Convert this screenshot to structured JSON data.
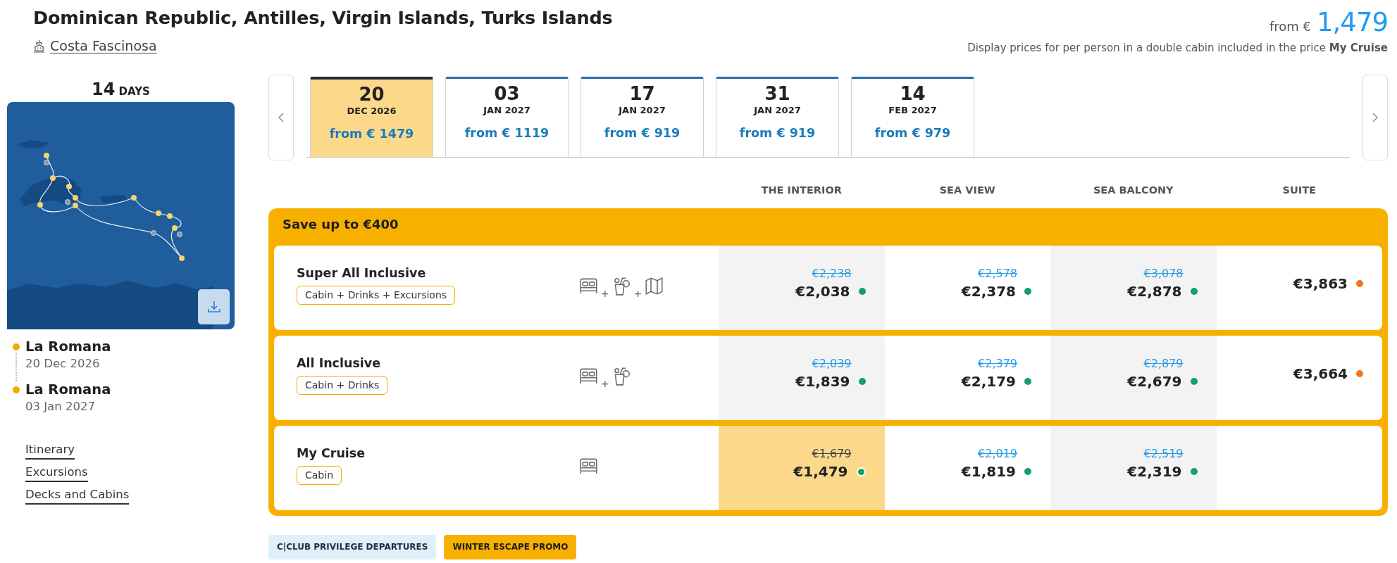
{
  "header": {
    "title": "Dominican Republic, Antilles, Virgin Islands, Turks Islands",
    "ship": "Costa Fascinosa",
    "price_prefix": "from €",
    "price": "1,479",
    "note": "Display prices for per person in a double cabin included in the price **My Cruise**"
  },
  "sidebar": {
    "duration": "14",
    "duration_unit": "DAYS",
    "stops": [
      {
        "port": "La Romana",
        "date": "20 Dec 2026"
      },
      {
        "port": "La Romana",
        "date": "03 Jan 2027"
      }
    ],
    "links": [
      "Itinerary",
      "Excursions",
      "Decks and Cabins"
    ]
  },
  "date_tabs": [
    {
      "day": "20",
      "month": "DEC 2026",
      "price": "from € 1479",
      "selected": true
    },
    {
      "day": "03",
      "month": "JAN 2027",
      "price": "from € 1119",
      "selected": false
    },
    {
      "day": "17",
      "month": "JAN 2027",
      "price": "from € 919",
      "selected": false
    },
    {
      "day": "31",
      "month": "JAN 2027",
      "price": "from € 919",
      "selected": false
    },
    {
      "day": "14",
      "month": "FEB 2027",
      "price": "from € 979",
      "selected": false
    }
  ],
  "cabin_columns": [
    "THE INTERIOR",
    "SEA VIEW",
    "SEA BALCONY",
    "SUITE"
  ],
  "offers": {
    "banner": "Save up to €400",
    "rows": [
      {
        "name": "Super All Inclusive",
        "badge": "Cabin + Drinks + Excursions",
        "includes": [
          {
            "kind": "cabin"
          },
          {
            "kind": "joiner",
            "text": "+"
          },
          {
            "kind": "drinks"
          },
          {
            "kind": "joiner",
            "text": "+"
          },
          {
            "kind": "excursions"
          }
        ],
        "prices": [
          {
            "old": "€2,238",
            "price": "€2,038",
            "color": "#14a060",
            "selected": false
          },
          {
            "old": "€2,578",
            "price": "€2,378",
            "color": "#14a060",
            "selected": false
          },
          {
            "old": "€3,078",
            "price": "€2,878",
            "color": "#14a060",
            "selected": false
          },
          {
            "price": "€3,863",
            "color": "#f5731b",
            "selected": false
          }
        ]
      },
      {
        "name": "All Inclusive",
        "badge": "Cabin + Drinks",
        "includes": [
          {
            "kind": "cabin"
          },
          {
            "kind": "joiner",
            "text": "+"
          },
          {
            "kind": "drinks"
          }
        ],
        "prices": [
          {
            "old": "€2,039",
            "price": "€1,839",
            "color": "#14a060",
            "selected": false
          },
          {
            "old": "€2,379",
            "price": "€2,179",
            "color": "#14a060",
            "selected": false
          },
          {
            "old": "€2,879",
            "price": "€2,679",
            "color": "#14a060",
            "selected": false
          },
          {
            "price": "€3,664",
            "color": "#f5731b",
            "selected": false
          }
        ]
      },
      {
        "name": "My Cruise",
        "badge": "Cabin",
        "includes": [
          {
            "kind": "cabin"
          }
        ],
        "prices": [
          {
            "old": "€1,679",
            "price": "€1,479",
            "color": "#14a060",
            "selected": true
          },
          {
            "old": "€2,019",
            "price": "€1,819",
            "color": "#14a060",
            "selected": false
          },
          {
            "old": "€2,519",
            "price": "€2,319",
            "color": "#14a060",
            "selected": false
          }
        ]
      }
    ]
  },
  "tags": [
    {
      "label": "C|CLUB PRIVILEGE DEPARTURES",
      "kind": "club"
    },
    {
      "label": "WINTER ESCAPE PROMO",
      "kind": "promo"
    }
  ]
}
